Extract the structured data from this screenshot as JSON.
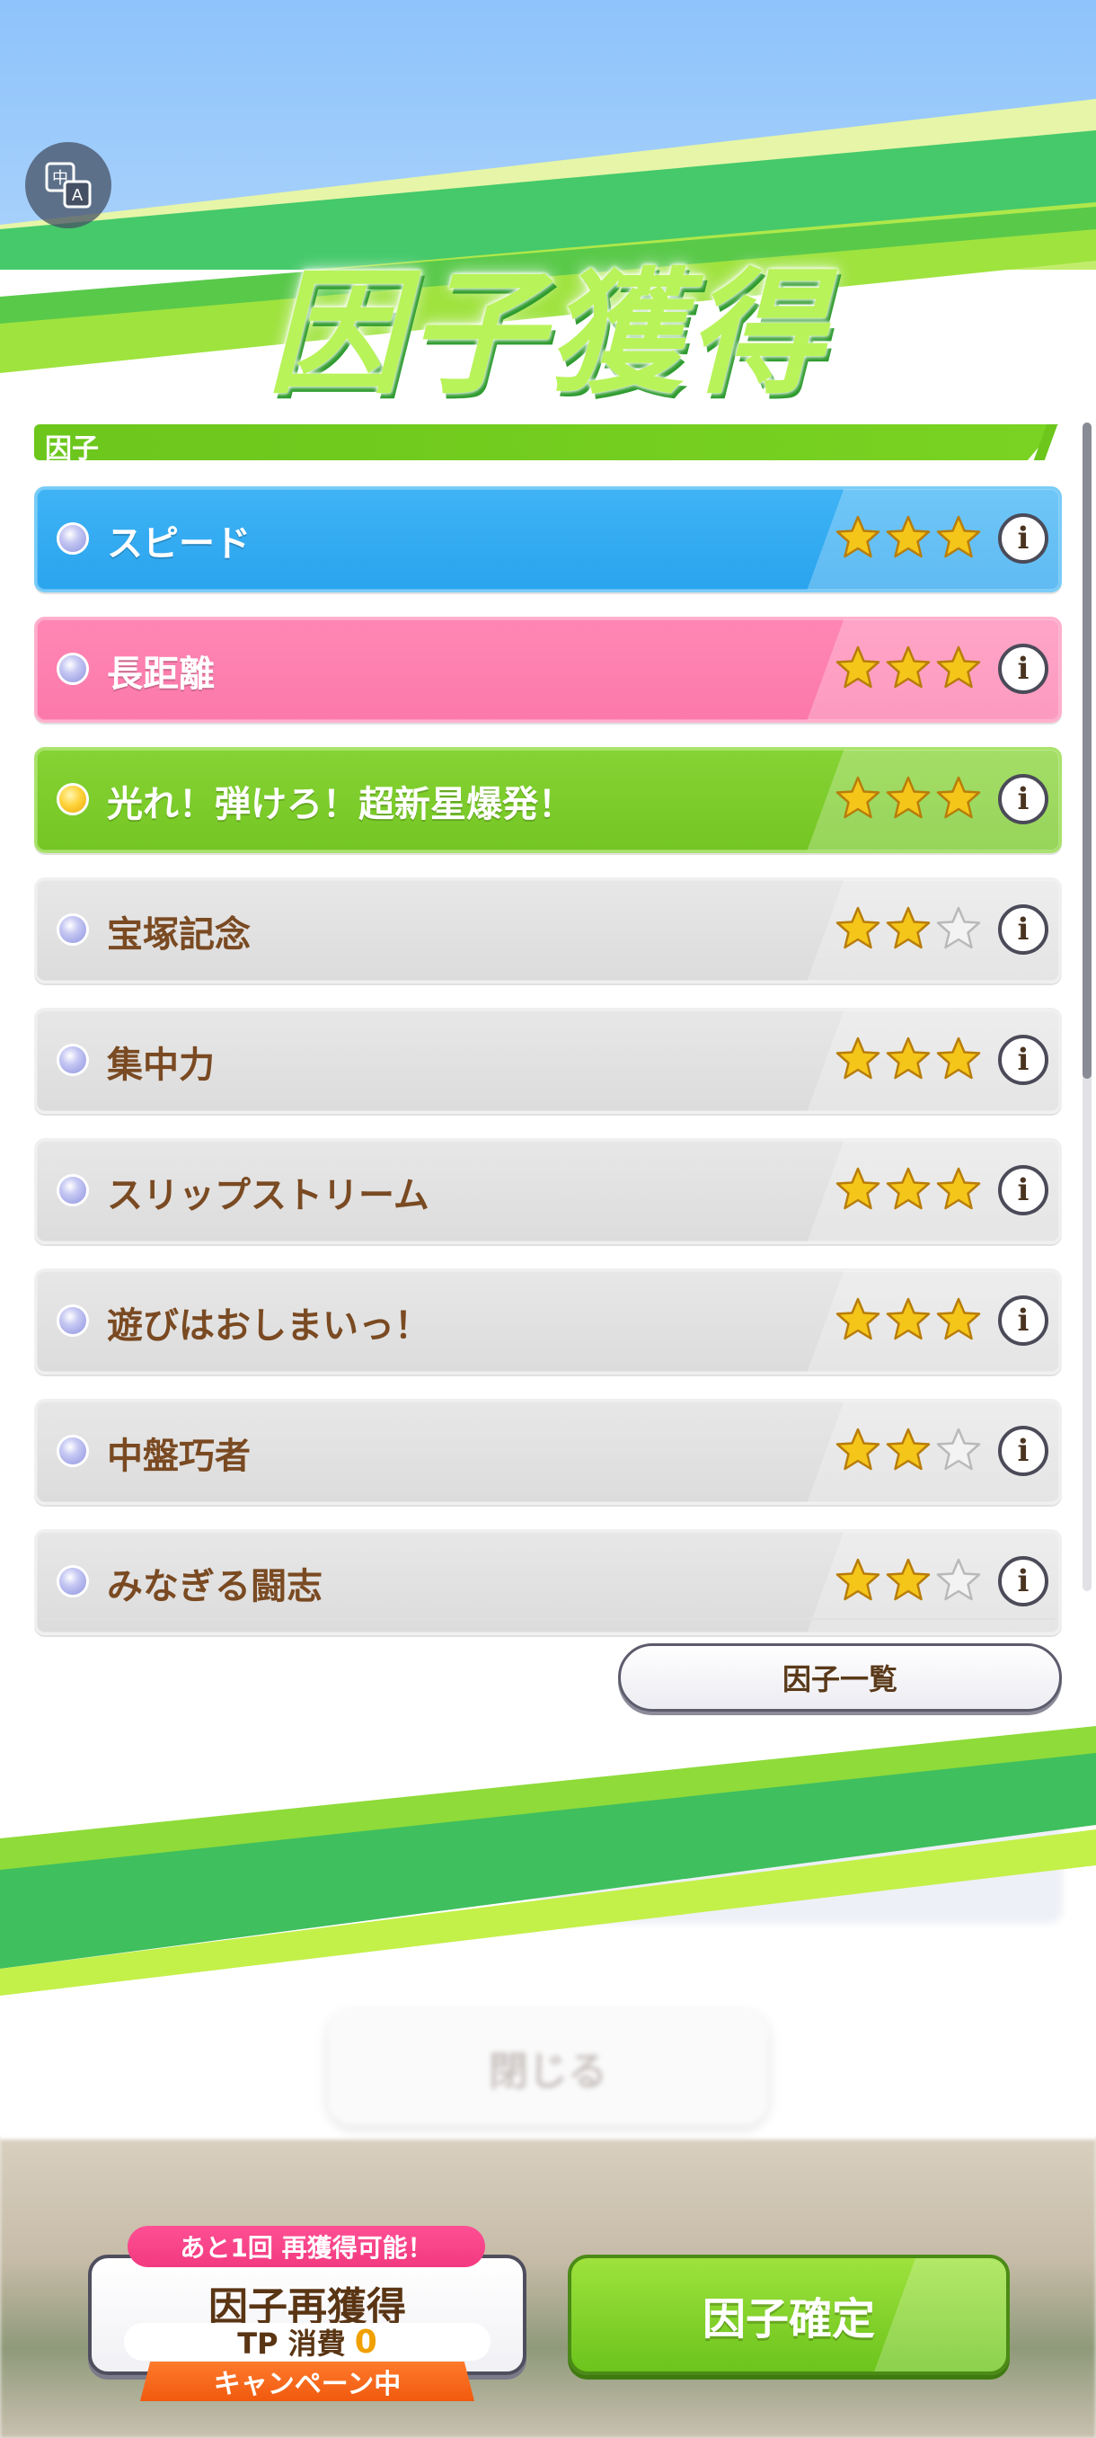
{
  "screen": {
    "title": "因子獲得",
    "translate_icon": "translate-icon"
  },
  "section": {
    "header": "因子"
  },
  "factors": [
    {
      "name": "スピード",
      "stars": 3,
      "color": "blue",
      "dot": "blue"
    },
    {
      "name": "長距離",
      "stars": 3,
      "color": "pink",
      "dot": "blue"
    },
    {
      "name": "光れ！弾けろ！超新星爆発！",
      "stars": 3,
      "color": "green",
      "dot": "gold"
    },
    {
      "name": "宝塚記念",
      "stars": 2,
      "color": "gray",
      "dot": "blue"
    },
    {
      "name": "集中力",
      "stars": 3,
      "color": "gray",
      "dot": "blue"
    },
    {
      "name": "スリップストリーム",
      "stars": 3,
      "color": "gray",
      "dot": "blue"
    },
    {
      "name": "遊びはおしまいっ！",
      "stars": 3,
      "color": "gray",
      "dot": "blue"
    },
    {
      "name": "中盤巧者",
      "stars": 2,
      "color": "gray",
      "dot": "blue"
    },
    {
      "name": "みなぎる闘志",
      "stars": 2,
      "color": "gray",
      "dot": "blue"
    }
  ],
  "info_icon_glyph": "i",
  "factor_list_button": "因子一覧",
  "background_close_button": "閉じる",
  "regain": {
    "badge": "あと1回 再獲得可能！",
    "title": "因子再獲得",
    "cost_label": "TP 消費",
    "cost_value": "0",
    "campaign": "キャンペーン中"
  },
  "confirm_button": "因子確定",
  "colors": {
    "accent_green": "#6cc61c",
    "star_gold": "#f5c61a",
    "label_brown": "#7a4a22",
    "blue_row": "#2aa4ee",
    "pink_row": "#fb79aa"
  }
}
